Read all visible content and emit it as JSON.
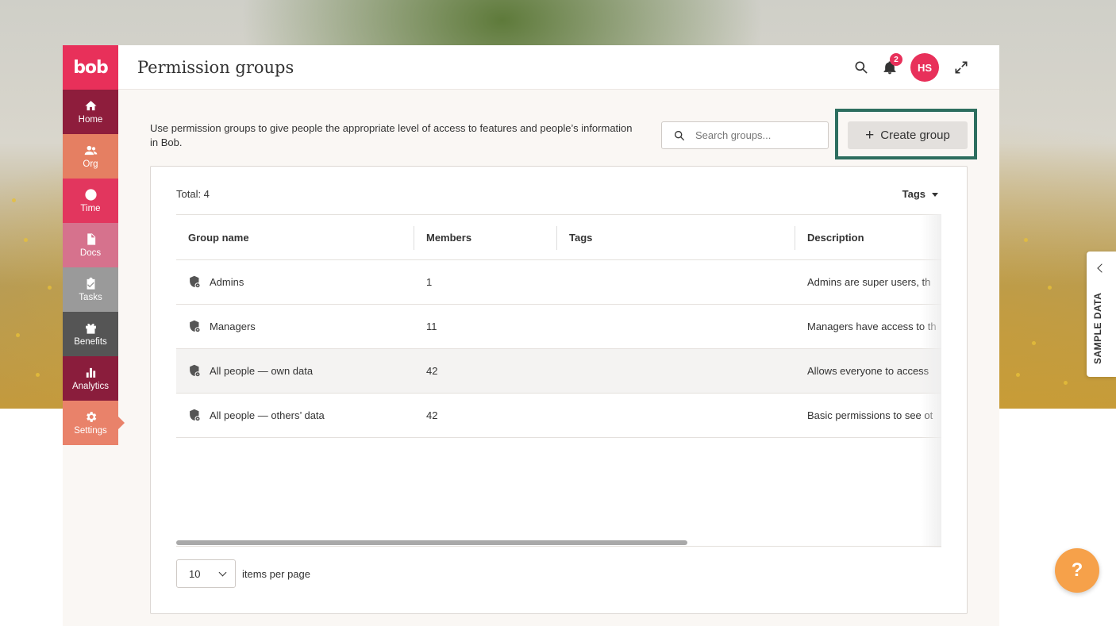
{
  "app": {
    "logo_text": "bob",
    "brand_color": "#e8305a",
    "highlight_color": "#2d6e5f"
  },
  "sidebar": {
    "items": [
      {
        "label": "Home",
        "icon": "home-icon",
        "color": "#8e1d3c"
      },
      {
        "label": "Org",
        "icon": "people-icon",
        "color": "#e57f62"
      },
      {
        "label": "Time",
        "icon": "clock-icon",
        "color": "#e2365e"
      },
      {
        "label": "Docs",
        "icon": "document-icon",
        "color": "#d6728d"
      },
      {
        "label": "Tasks",
        "icon": "clipboard-check-icon",
        "color": "#9a9a9a"
      },
      {
        "label": "Benefits",
        "icon": "gift-icon",
        "color": "#555555"
      },
      {
        "label": "Analytics",
        "icon": "bar-chart-icon",
        "color": "#8a1d3c"
      },
      {
        "label": "Settings",
        "icon": "gear-icon",
        "color": "#e9826a",
        "active": true
      }
    ]
  },
  "header": {
    "title": "Permission groups",
    "notification_count": "2",
    "avatar_initials": "HS"
  },
  "intro_text": "Use permission groups to give people the appropriate level of access to features and people’s information in Bob.",
  "search": {
    "placeholder": "Search groups..."
  },
  "create_button": {
    "label": "Create group"
  },
  "table": {
    "total_label": "Total: 4",
    "tags_filter_label": "Tags",
    "columns": [
      "Group name",
      "Members",
      "Tags",
      "Description"
    ],
    "rows": [
      {
        "name": "Admins",
        "members": "1",
        "tags": "",
        "description": "Admins are super users, th"
      },
      {
        "name": "Managers",
        "members": "11",
        "tags": "",
        "description": "Managers have access to th"
      },
      {
        "name": "All people — own data",
        "members": "42",
        "tags": "",
        "description": "Allows everyone to access"
      },
      {
        "name": "All people — others’ data",
        "members": "42",
        "tags": "",
        "description": "Basic permissions to see ot"
      }
    ]
  },
  "pagination": {
    "page_size": "10",
    "label": "items per page"
  },
  "sample_data_tab": {
    "label": "SAMPLE DATA"
  },
  "help_button": {
    "label": "?"
  }
}
